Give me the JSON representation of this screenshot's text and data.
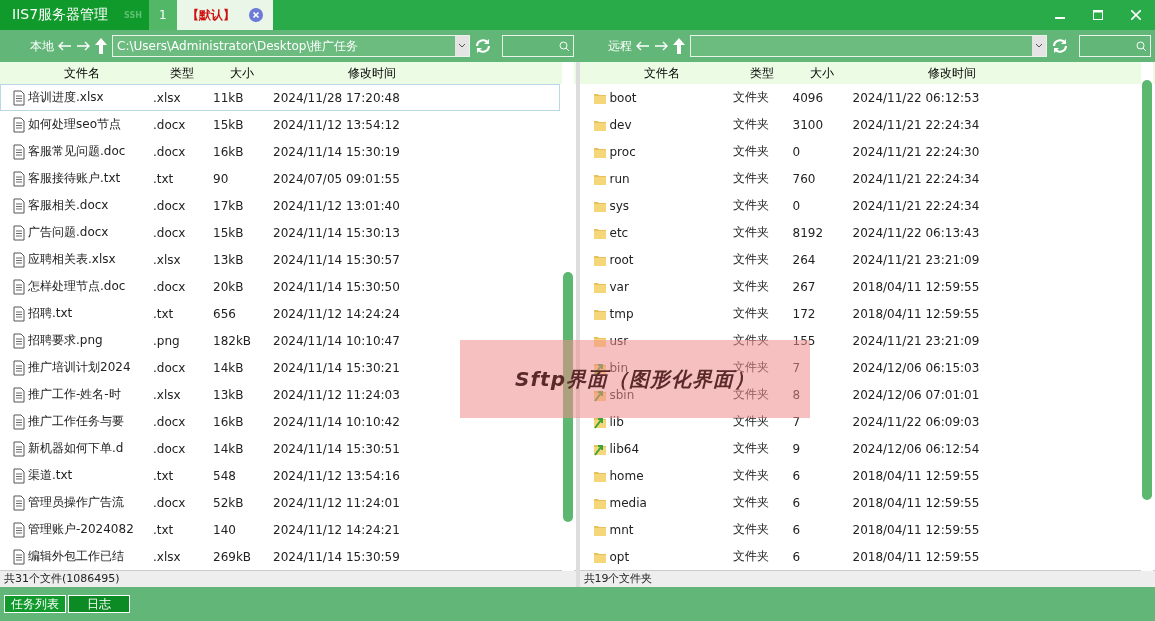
{
  "window": {
    "title": "IIS7服务器管理",
    "badge": "SSH"
  },
  "tabs": [
    {
      "label": "1",
      "selected": false
    },
    {
      "label": "【默认】",
      "selected": true
    }
  ],
  "local": {
    "label": "本地",
    "path": "C:\\Users\\Administrator\\Desktop\\推广任务",
    "columns": [
      "文件名",
      "类型",
      "大小",
      "修改时间"
    ],
    "rows": [
      {
        "name": "培训进度.xlsx",
        "type": ".xlsx",
        "size": "11kB",
        "modified": "2024/11/28 17:20:48",
        "selected": true
      },
      {
        "name": "如何处理seo节点",
        "type": ".docx",
        "size": "15kB",
        "modified": "2024/11/12 13:54:12",
        "selected": false
      },
      {
        "name": "客服常见问题.doc",
        "type": ".docx",
        "size": "16kB",
        "modified": "2024/11/14 15:30:19",
        "selected": false
      },
      {
        "name": "客服接待账户.txt",
        "type": ".txt",
        "size": "90",
        "modified": "2024/07/05 09:01:55",
        "selected": false
      },
      {
        "name": "客服相关.docx",
        "type": ".docx",
        "size": "17kB",
        "modified": "2024/11/12 13:01:40",
        "selected": false
      },
      {
        "name": "广告问题.docx",
        "type": ".docx",
        "size": "15kB",
        "modified": "2024/11/14 15:30:13",
        "selected": false
      },
      {
        "name": "应聘相关表.xlsx",
        "type": ".xlsx",
        "size": "13kB",
        "modified": "2024/11/14 15:30:57",
        "selected": false
      },
      {
        "name": "怎样处理节点.doc",
        "type": ".docx",
        "size": "20kB",
        "modified": "2024/11/14 15:30:50",
        "selected": false
      },
      {
        "name": "招聘.txt",
        "type": ".txt",
        "size": "656",
        "modified": "2024/11/12 14:24:24",
        "selected": false
      },
      {
        "name": "招聘要求.png",
        "type": ".png",
        "size": "182kB",
        "modified": "2024/11/14 10:10:47",
        "selected": false
      },
      {
        "name": "推广培训计划2024",
        "type": ".docx",
        "size": "14kB",
        "modified": "2024/11/14 15:30:21",
        "selected": false
      },
      {
        "name": "推广工作-姓名-时",
        "type": ".xlsx",
        "size": "13kB",
        "modified": "2024/11/12 11:24:03",
        "selected": false
      },
      {
        "name": "推广工作任务与要",
        "type": ".docx",
        "size": "16kB",
        "modified": "2024/11/14 10:10:42",
        "selected": false
      },
      {
        "name": "新机器如何下单.d",
        "type": ".docx",
        "size": "14kB",
        "modified": "2024/11/14 15:30:51",
        "selected": false
      },
      {
        "name": "渠道.txt",
        "type": ".txt",
        "size": "548",
        "modified": "2024/11/12 13:54:16",
        "selected": false
      },
      {
        "name": "管理员操作广告流",
        "type": ".docx",
        "size": "52kB",
        "modified": "2024/11/12 11:24:01",
        "selected": false
      },
      {
        "name": "管理账户-2024082",
        "type": ".txt",
        "size": "140",
        "modified": "2024/11/12 14:24:21",
        "selected": false
      },
      {
        "name": "编辑外包工作已结",
        "type": ".xlsx",
        "size": "269kB",
        "modified": "2024/11/14 15:30:59",
        "selected": false
      }
    ],
    "status": "共31个文件(1086495)"
  },
  "remote": {
    "label": "远程",
    "columns": [
      "文件名",
      "类型",
      "大小",
      "修改时间"
    ],
    "rows": [
      {
        "kind": "folder",
        "name": "boot",
        "type": "文件夹",
        "size": "4096",
        "modified": "2024/11/22 06:12:53"
      },
      {
        "kind": "folder",
        "name": "dev",
        "type": "文件夹",
        "size": "3100",
        "modified": "2024/11/21 22:24:34"
      },
      {
        "kind": "folder",
        "name": "proc",
        "type": "文件夹",
        "size": "0",
        "modified": "2024/11/21 22:24:30"
      },
      {
        "kind": "folder",
        "name": "run",
        "type": "文件夹",
        "size": "760",
        "modified": "2024/11/21 22:24:34"
      },
      {
        "kind": "folder",
        "name": "sys",
        "type": "文件夹",
        "size": "0",
        "modified": "2024/11/21 22:24:34"
      },
      {
        "kind": "folder",
        "name": "etc",
        "type": "文件夹",
        "size": "8192",
        "modified": "2024/11/22 06:13:43"
      },
      {
        "kind": "folder",
        "name": "root",
        "type": "文件夹",
        "size": "264",
        "modified": "2024/11/21 23:21:09"
      },
      {
        "kind": "folder",
        "name": "var",
        "type": "文件夹",
        "size": "267",
        "modified": "2018/04/11 12:59:55"
      },
      {
        "kind": "folder",
        "name": "tmp",
        "type": "文件夹",
        "size": "172",
        "modified": "2018/04/11 12:59:55"
      },
      {
        "kind": "folder",
        "name": "usr",
        "type": "文件夹",
        "size": "155",
        "modified": "2024/11/21 23:21:09"
      },
      {
        "kind": "link",
        "name": "bin",
        "type": "文件夹",
        "size": "7",
        "modified": "2024/12/06 06:15:03"
      },
      {
        "kind": "link",
        "name": "sbin",
        "type": "文件夹",
        "size": "8",
        "modified": "2024/12/06 07:01:01"
      },
      {
        "kind": "link",
        "name": "lib",
        "type": "文件夹",
        "size": "7",
        "modified": "2024/11/22 06:09:03"
      },
      {
        "kind": "link",
        "name": "lib64",
        "type": "文件夹",
        "size": "9",
        "modified": "2024/12/06 06:12:54"
      },
      {
        "kind": "folder",
        "name": "home",
        "type": "文件夹",
        "size": "6",
        "modified": "2018/04/11 12:59:55"
      },
      {
        "kind": "folder",
        "name": "media",
        "type": "文件夹",
        "size": "6",
        "modified": "2018/04/11 12:59:55"
      },
      {
        "kind": "folder",
        "name": "mnt",
        "type": "文件夹",
        "size": "6",
        "modified": "2018/04/11 12:59:55"
      },
      {
        "kind": "folder",
        "name": "opt",
        "type": "文件夹",
        "size": "6",
        "modified": "2018/04/11 12:59:55"
      }
    ],
    "status": "共19个文件夹"
  },
  "bottom_tabs": [
    {
      "label": "任务列表",
      "selected": true
    },
    {
      "label": "日志",
      "selected": false
    }
  ],
  "annotation": "Sftp界面（图形化界面）"
}
